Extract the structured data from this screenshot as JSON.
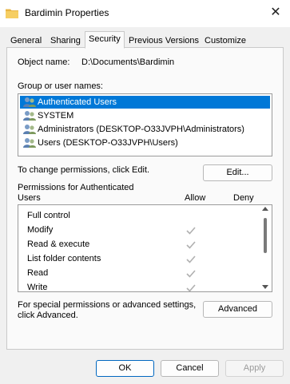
{
  "window": {
    "title": "Bardimin Properties",
    "close_glyph": "✕"
  },
  "tabs": [
    {
      "label": "General"
    },
    {
      "label": "Sharing"
    },
    {
      "label": "Security",
      "active": true
    },
    {
      "label": "Previous Versions"
    },
    {
      "label": "Customize"
    }
  ],
  "object": {
    "label": "Object name:",
    "value": "D:\\Documents\\Bardimin"
  },
  "groups": {
    "label": "Group or user names:",
    "items": [
      {
        "label": "Authenticated Users",
        "icon": "users-icon",
        "selected": true
      },
      {
        "label": "SYSTEM",
        "icon": "users-icon"
      },
      {
        "label": "Administrators (DESKTOP-O33JVPH\\Administrators)",
        "icon": "users-icon"
      },
      {
        "label": "Users (DESKTOP-O33JVPH\\Users)",
        "icon": "users-icon"
      }
    ]
  },
  "change_permissions": {
    "text": "To change permissions, click Edit.",
    "button": "Edit..."
  },
  "permissions": {
    "label_line1": "Permissions for Authenticated",
    "label_line2": "Users",
    "allow_header": "Allow",
    "deny_header": "Deny",
    "rows": [
      {
        "label": "Full control",
        "allow": false,
        "deny": false
      },
      {
        "label": "Modify",
        "allow": true,
        "deny": false
      },
      {
        "label": "Read & execute",
        "allow": true,
        "deny": false
      },
      {
        "label": "List folder contents",
        "allow": true,
        "deny": false
      },
      {
        "label": "Read",
        "allow": true,
        "deny": false
      },
      {
        "label": "Write",
        "allow": true,
        "deny": false
      }
    ]
  },
  "advanced": {
    "text_line1": "For special permissions or advanced settings,",
    "text_line2": "click Advanced.",
    "button": "Advanced"
  },
  "footer": {
    "ok": "OK",
    "cancel": "Cancel",
    "apply": "Apply"
  },
  "colors": {
    "selection": "#0078d7",
    "primary_border": "#0067c0",
    "check": "#b0b0b0",
    "folder": "#f2c14e"
  }
}
